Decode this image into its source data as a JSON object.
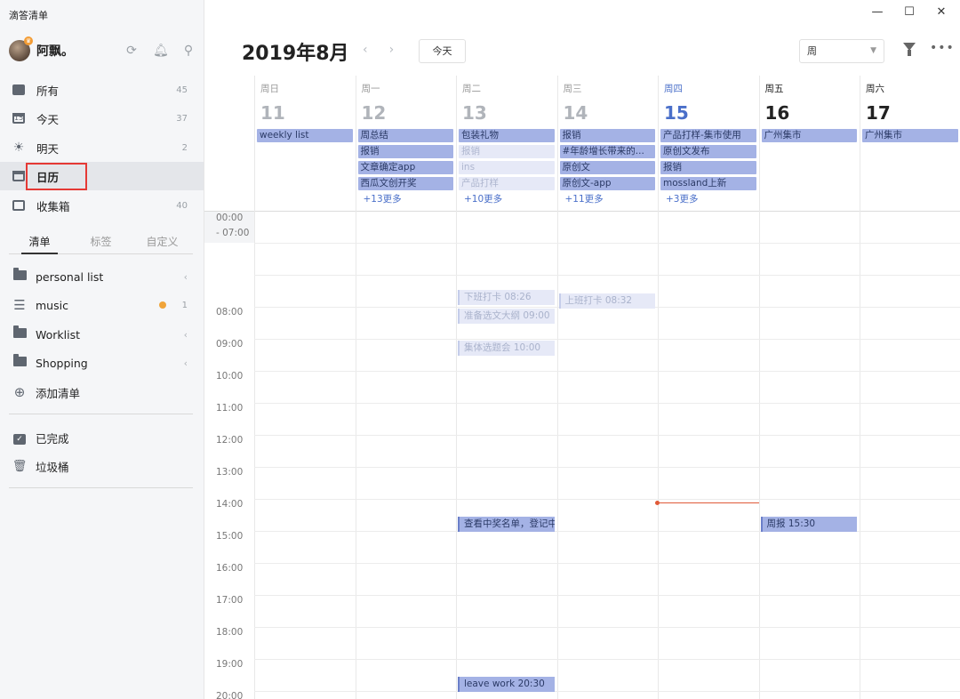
{
  "app": {
    "title": "滴答清单"
  },
  "user": {
    "name": "阿飘。"
  },
  "nav": [
    {
      "label": "所有",
      "count": "45"
    },
    {
      "label": "今天",
      "count": "37"
    },
    {
      "label": "明天",
      "count": "2"
    },
    {
      "label": "日历",
      "count": ""
    },
    {
      "label": "收集箱",
      "count": "40"
    }
  ],
  "list_tabs": [
    "清单",
    "标签",
    "自定义"
  ],
  "lists": [
    {
      "label": "personal list"
    },
    {
      "label": "music",
      "count": "1",
      "badge_color": "#f0a43a"
    },
    {
      "label": "Worklist"
    },
    {
      "label": "Shopping"
    },
    {
      "label": "添加清单"
    }
  ],
  "footer": [
    {
      "label": "已完成"
    },
    {
      "label": "垃圾桶"
    }
  ],
  "header": {
    "month": "2019年8月",
    "today_button": "今天",
    "view_mode": "周"
  },
  "days": [
    {
      "name": "周日",
      "date": "11",
      "style": "past"
    },
    {
      "name": "周一",
      "date": "12",
      "style": "past"
    },
    {
      "name": "周二",
      "date": "13",
      "style": "past"
    },
    {
      "name": "周三",
      "date": "14",
      "style": "past"
    },
    {
      "name": "周四",
      "date": "15",
      "style": "today"
    },
    {
      "name": "周五",
      "date": "16",
      "style": "future"
    },
    {
      "name": "周六",
      "date": "17",
      "style": "future"
    }
  ],
  "allday": [
    {
      "items": [
        {
          "text": "weekly list",
          "faded": false
        }
      ],
      "more": ""
    },
    {
      "items": [
        {
          "text": "周总结",
          "faded": false
        },
        {
          "text": "报销",
          "faded": false
        },
        {
          "text": "文章确定app",
          "faded": false
        },
        {
          "text": "西瓜文创开奖",
          "faded": false
        }
      ],
      "more": "+13更多"
    },
    {
      "items": [
        {
          "text": "包装礼物",
          "faded": false
        },
        {
          "text": "报销",
          "faded": true
        },
        {
          "text": "ins",
          "faded": true
        },
        {
          "text": "产品打样",
          "faded": true
        }
      ],
      "more": "+10更多"
    },
    {
      "items": [
        {
          "text": "报销",
          "faded": false
        },
        {
          "text": "#年龄增长带来的...",
          "faded": false
        },
        {
          "text": "原创文",
          "faded": false
        },
        {
          "text": "原创文-app",
          "faded": false
        }
      ],
      "more": "+11更多"
    },
    {
      "items": [
        {
          "text": "产品打样-集市使用",
          "faded": false
        },
        {
          "text": "原创文发布",
          "faded": false
        },
        {
          "text": "报销",
          "faded": false
        },
        {
          "text": "mossland上新",
          "faded": false
        }
      ],
      "more": "+3更多"
    },
    {
      "items": [
        {
          "text": "广州集市",
          "faded": false
        }
      ],
      "more": ""
    },
    {
      "items": [
        {
          "text": "广州集市",
          "faded": false
        }
      ],
      "more": ""
    }
  ],
  "time_labels": [
    "00:00",
    "- 07:00",
    "08:00",
    "09:00",
    "10:00",
    "11:00",
    "12:00",
    "13:00",
    "14:00",
    "15:00",
    "16:00",
    "17:00",
    "18:00",
    "19:00",
    "20:00"
  ],
  "events": [
    {
      "day": 2,
      "hour": 8.43,
      "text": "下班打卡 08:26",
      "faded": true
    },
    {
      "day": 2,
      "hour": 9.0,
      "text": "准备选文大纲 09:00",
      "faded": true
    },
    {
      "day": 2,
      "hour": 10.0,
      "text": "集体选题会 10:00",
      "faded": true
    },
    {
      "day": 3,
      "hour": 8.53,
      "text": "上班打卡 08:32",
      "faded": true
    },
    {
      "day": 2,
      "hour": 15.5,
      "text": "查看中奖名单，登记中奖信息",
      "faded": false
    },
    {
      "day": 5,
      "hour": 15.5,
      "text": "周报 15:30",
      "faded": false
    },
    {
      "day": 2,
      "hour": 20.5,
      "text": "leave work 20:30",
      "faded": false
    }
  ],
  "now": {
    "day": 4,
    "hour": 14.8,
    "color": "#e05a38"
  },
  "colors": {
    "accent": "#4a6fc9",
    "event": "#a4b2e5",
    "event_faded": "#e6e9f7",
    "highlight": "#e53935"
  }
}
